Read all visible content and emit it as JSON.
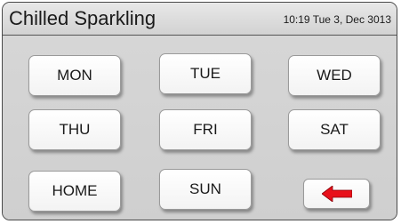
{
  "header": {
    "title": "Chilled Sparkling",
    "datetime": "10:19 Tue 3, Dec 3013"
  },
  "days": {
    "mon": "MON",
    "tue": "TUE",
    "wed": "WED",
    "thu": "THU",
    "fri": "FRI",
    "sat": "SAT",
    "sun": "SUN"
  },
  "nav": {
    "home": "HOME",
    "back_icon": "left-arrow-icon"
  },
  "colors": {
    "arrow": "#e8101a",
    "panel": "#d4d4d4"
  }
}
